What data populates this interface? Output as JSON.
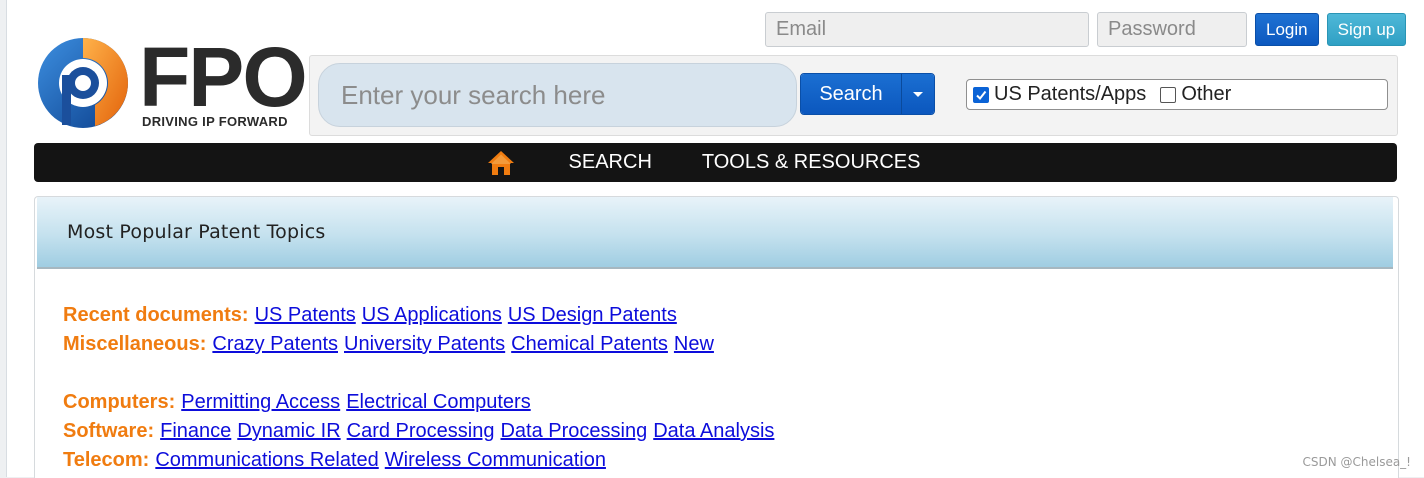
{
  "auth": {
    "email_placeholder": "Email",
    "password_placeholder": "Password",
    "login_label": "Login",
    "signup_label": "Sign up"
  },
  "logo": {
    "word": "FPO",
    "tagline": "DRIVING IP FORWARD"
  },
  "search": {
    "placeholder": "Enter your search here",
    "button_label": "Search",
    "scopes": [
      {
        "label": "US Patents/Apps",
        "checked": true
      },
      {
        "label": "Other",
        "checked": false
      }
    ]
  },
  "nav": {
    "home_icon": "home-icon",
    "items": [
      "SEARCH",
      "TOOLS & RESOURCES"
    ]
  },
  "topics": {
    "title": "Most Popular Patent Topics",
    "rows": [
      {
        "category": "Recent documents:",
        "links": [
          "US Patents",
          "US Applications",
          "US Design Patents"
        ]
      },
      {
        "category": "Miscellaneous:",
        "links": [
          "Crazy Patents",
          "University Patents",
          "Chemical Patents",
          "New"
        ]
      },
      {
        "category": "Computers:",
        "links": [
          "Permitting Access",
          "Electrical Computers"
        ]
      },
      {
        "category": "Software:",
        "links": [
          "Finance",
          "Dynamic IR",
          "Card Processing",
          "Data Processing",
          "Data Analysis"
        ]
      },
      {
        "category": "Telecom:",
        "links": [
          "Communications Related",
          "Wireless Communication"
        ]
      }
    ]
  },
  "watermark": "CSDN @Chelsea_!",
  "colors": {
    "accent_orange": "#f07c10",
    "link_blue": "#0d0ddb",
    "button_blue": "#0b57be",
    "signup_teal": "#2fa0c4",
    "nav_black": "#141414"
  }
}
